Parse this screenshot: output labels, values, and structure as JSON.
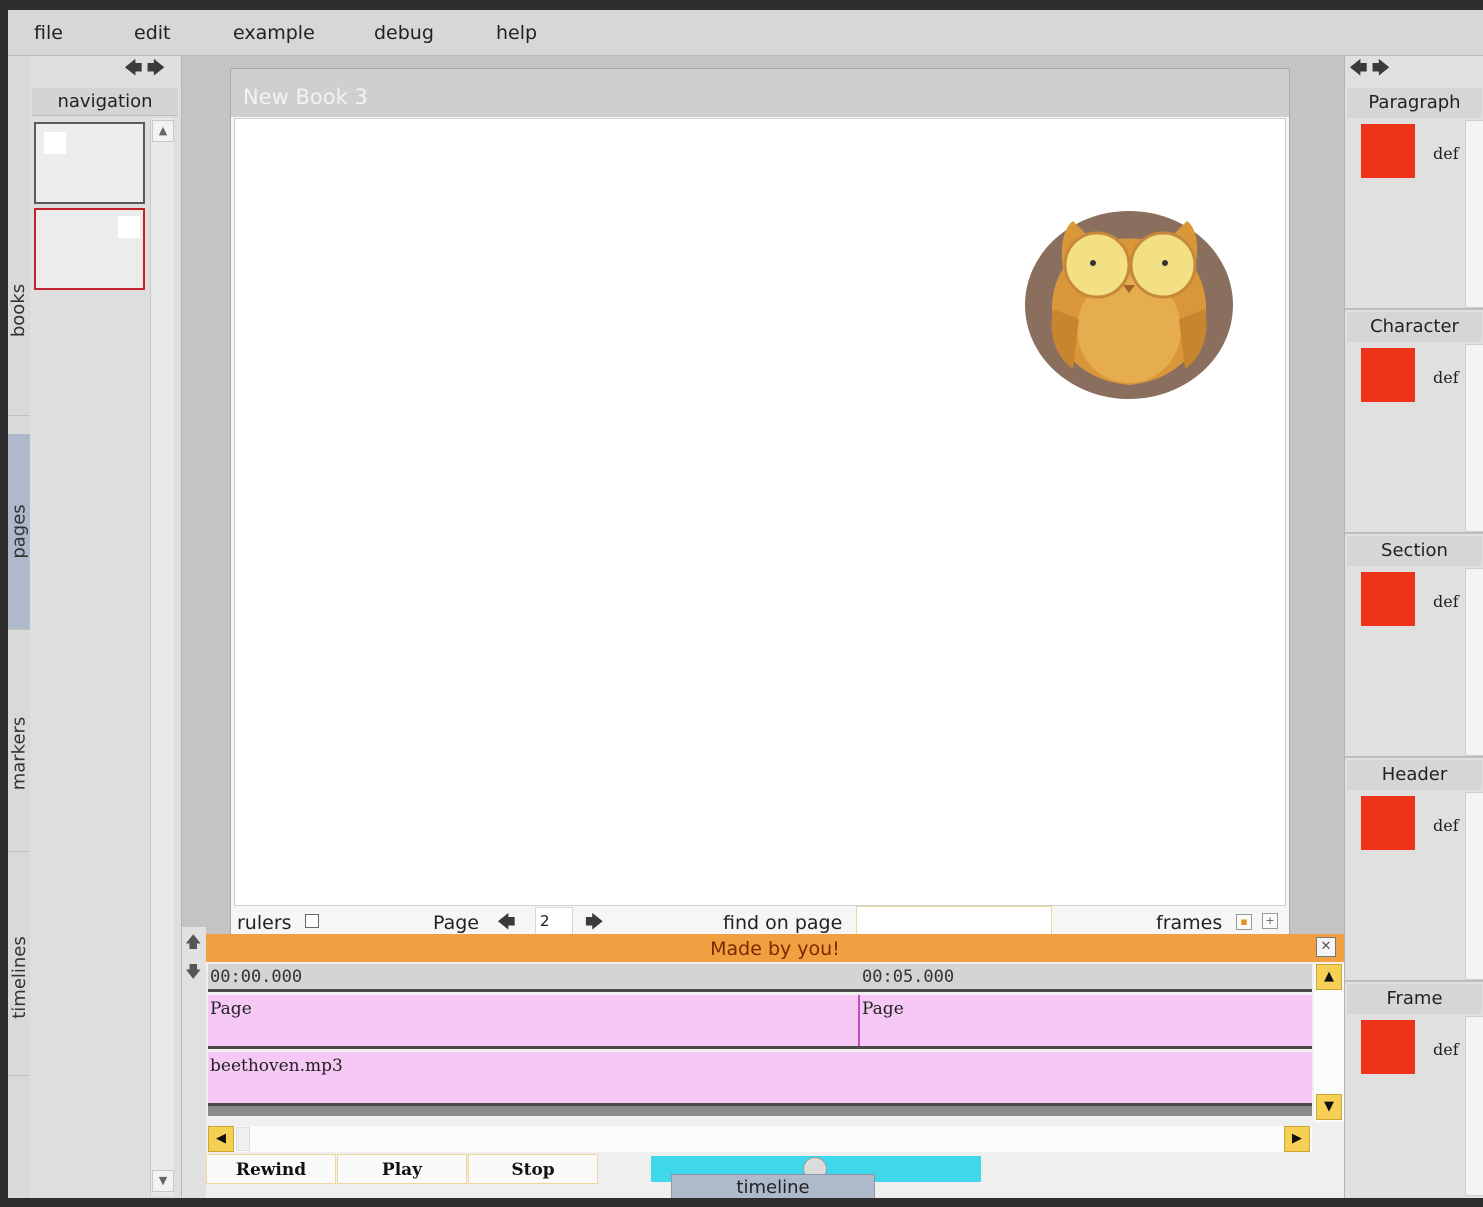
{
  "menu": [
    "file",
    "edit",
    "example",
    "debug",
    "help"
  ],
  "left_tabs": [
    "books",
    "pages",
    "markers",
    "timelines"
  ],
  "nav": {
    "title": "navigation"
  },
  "book": {
    "title": "New Book 3",
    "footer": {
      "rulers_label": "rulers",
      "page_label": "Page",
      "page_value": "2",
      "find_label": "find on page",
      "frames_label": "frames"
    }
  },
  "timeline": {
    "banner": "Made by you!",
    "ruler_ticks": [
      "00:00.000",
      "00:05.000"
    ],
    "tracks": [
      {
        "clips": [
          "Page",
          "Page"
        ]
      },
      {
        "clips": [
          "beethoven.mp3"
        ]
      }
    ],
    "buttons": [
      "Rewind",
      "Play",
      "Stop"
    ],
    "tab_label": "timeline"
  },
  "styles": [
    {
      "title": "Paragraph",
      "name": "def",
      "color": "#ee3418"
    },
    {
      "title": "Character",
      "name": "def",
      "color": "#ee3418"
    },
    {
      "title": "Section",
      "name": "def",
      "color": "#ee3418"
    },
    {
      "title": "Header",
      "name": "def",
      "color": "#ee3418"
    },
    {
      "title": "Frame",
      "name": "def",
      "color": "#ee3418"
    }
  ],
  "icons": [
    "back-arrow-icon",
    "forward-arrow-icon",
    "owl-image",
    "close-icon",
    "up-arrow-icon",
    "down-arrow-icon"
  ]
}
